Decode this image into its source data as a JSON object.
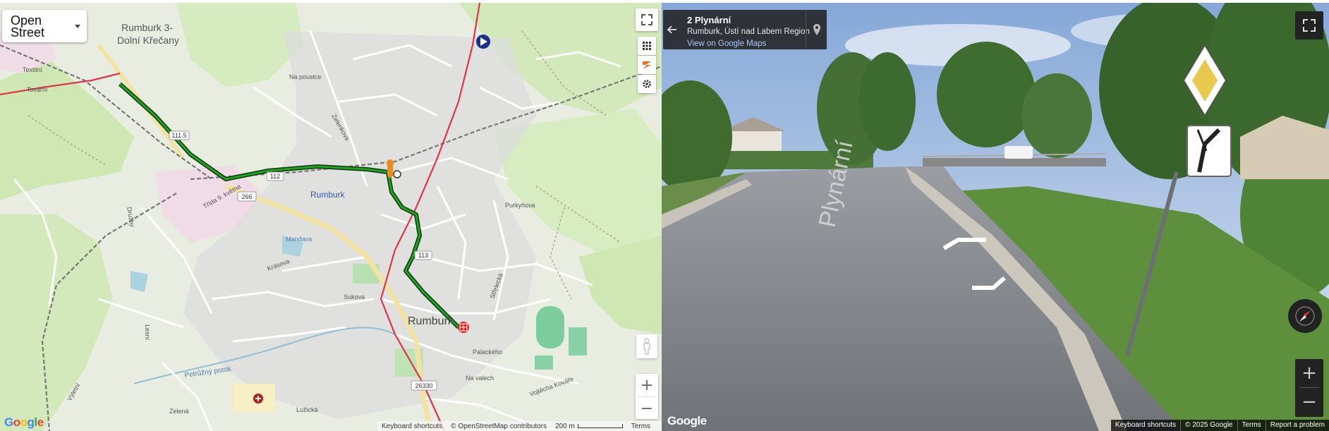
{
  "map": {
    "layer_select": {
      "line1": "Open",
      "line2": "Street"
    },
    "controls": [
      "fullscreen-icon",
      "grid-icon",
      "strava-icon",
      "gear-icon"
    ],
    "labels": {
      "rumburk3": "Rumburk 3-",
      "dolni": "Dolní Křečany",
      "rumburk_station": "Rumburk",
      "rumburk_town": "Rumburk",
      "textilni": "Textilní",
      "tovarni": "Tovární",
      "na_poustce": "Na poustce",
      "zelenkova": "Zelenkova",
      "krasova": "Krásova",
      "strelecka": "Střelecká",
      "sukova": "Sukova",
      "lesni": "Lesní",
      "vojtecha": "Vojtěcha Kováře",
      "na_valech": "Na valech",
      "palackeho": "Palackého",
      "petruzny": "Petrůžný potok",
      "mandava": "Mandava",
      "trida": "Třída 9. května",
      "purkynova": "Purkyňova",
      "druzby": "Družby",
      "zelena": "Zelená",
      "vyletni": "Výletní",
      "luzicka": "Lužická"
    },
    "road_numbers": {
      "r266": "266",
      "r112": "112",
      "r113": "113",
      "r26330": "26330",
      "km": "111.5"
    },
    "footer": {
      "shortcuts": "Keyboard shortcuts",
      "osm": "© OpenStreetMap contributors",
      "scale": "200 m",
      "terms": "Terms"
    },
    "zoom": {
      "in": "+",
      "out": "−"
    }
  },
  "streetview": {
    "address_title": "2 Plynární",
    "address_sub": "Rumburk, Ústí nad Labem Region",
    "address_link": "View on Google Maps",
    "road_text": "Plynární",
    "footer": {
      "shortcuts": "Keyboard shortcuts",
      "copyright": "© 2025 Google",
      "terms": "Terms",
      "report": "Report a problem"
    },
    "zoom": {
      "in": "+",
      "out": "−"
    }
  },
  "google_logo": "Google",
  "colors": {
    "route": "#1c7a1c",
    "rail": "#d33",
    "sky": "#a9c2e3",
    "road": "#8a8d91"
  }
}
